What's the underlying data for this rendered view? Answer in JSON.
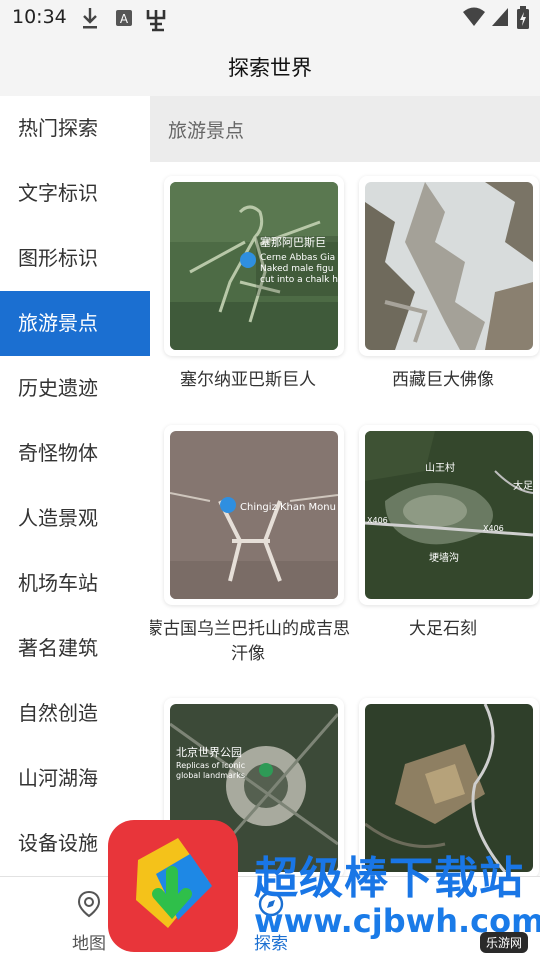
{
  "status_bar": {
    "time": "10:34",
    "icons": [
      "download-icon",
      "a-box-icon",
      "bug-icon",
      "wifi-icon",
      "signal-icon",
      "battery-icon"
    ]
  },
  "app_bar": {
    "title": "探索世界"
  },
  "sidebar": {
    "items": [
      {
        "label": "热门探索",
        "active": false
      },
      {
        "label": "文字标识",
        "active": false
      },
      {
        "label": "图形标识",
        "active": false
      },
      {
        "label": "旅游景点",
        "active": true
      },
      {
        "label": "历史遗迹",
        "active": false
      },
      {
        "label": "奇怪物体",
        "active": false
      },
      {
        "label": "人造景观",
        "active": false
      },
      {
        "label": "机场车站",
        "active": false
      },
      {
        "label": "著名建筑",
        "active": false
      },
      {
        "label": "自然创造",
        "active": false
      },
      {
        "label": "山河湖海",
        "active": false
      },
      {
        "label": "设备设施",
        "active": false
      }
    ]
  },
  "section": {
    "title": "旅游景点"
  },
  "cards": [
    {
      "label": "塞尔纳亚巴斯巨人",
      "map_text": [
        "塞那阿巴斯巨",
        "Cerne Abbas Gia",
        "Naked male figu",
        "cut into a chalk h"
      ]
    },
    {
      "label": "西藏巨大佛像",
      "map_text": []
    },
    {
      "label": "蒙古国乌兰巴托山的成吉思汗像",
      "map_text": [
        "Chingiz Khan Monu"
      ]
    },
    {
      "label": "大足石刻",
      "map_text": [
        "山王村",
        "大足",
        "X406",
        "X406",
        "埂墙沟"
      ]
    },
    {
      "label": "",
      "map_text": [
        "北京世界公园",
        "Replicas of iconic",
        "global landmarks"
      ]
    },
    {
      "label": "",
      "map_text": []
    }
  ],
  "bottom_nav": {
    "tabs": [
      {
        "label": "地图",
        "icon": "map-pin-icon",
        "active": false
      },
      {
        "label": "探索",
        "icon": "explore-icon",
        "active": true
      }
    ]
  },
  "watermark": {
    "title": "超级棒下载站",
    "url": "www.cjbwh.com",
    "badge": "乐游网"
  },
  "colors": {
    "accent": "#1b6fd1",
    "watermark_blue": "#1976e6",
    "watermark_red": "#e8353a"
  }
}
